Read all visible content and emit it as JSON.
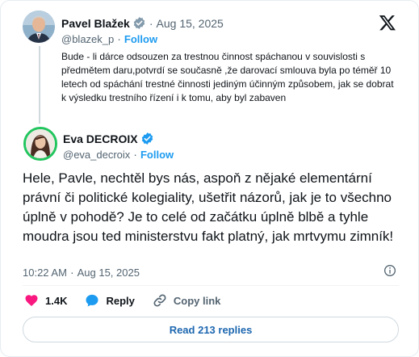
{
  "parent_tweet": {
    "author_name": "Pavel Blažek",
    "date": "Aug 15, 2025",
    "handle": "@blazek_p",
    "follow_label": "Follow",
    "text": "Bude - li dárce odsouzen za trestnou činnost spáchanou v souvislosti s předmětem daru,potvrdí  se současně ,že darovací smlouva byla po téměř 10 letech od spáchání trestné činnosti jediným účinným způsobem, jak se dobrat k výsledku trestního řízení i k tomu, aby byl zabaven"
  },
  "main_tweet": {
    "author_name": "Eva DECROIX",
    "handle": "@eva_decroix",
    "follow_label": "Follow",
    "text": "Hele, Pavle, nechtěl bys nás, aspoň z nějaké elementární právní či politické kolegiality, ušetřit názorů, jak je to všechno úplně v pohodě? Je to celé od začátku úplně blbě a tyhle moudra jsou ted ministerstvu fakt platný, jak mrtvymu zimník!",
    "time": "10:22 AM",
    "date": "Aug 15, 2025"
  },
  "actions": {
    "likes": "1.4K",
    "reply_label": "Reply",
    "copy_link_label": "Copy link"
  },
  "read_replies_label": "Read 213 replies",
  "separator_dot": "·",
  "colors": {
    "accent": "#1d9bf0",
    "like": "#f91880",
    "avatar_ring": "#22c55e",
    "muted": "#536471"
  },
  "icons": [
    "x-logo-icon",
    "verified-badge-icon",
    "info-icon",
    "heart-icon",
    "reply-bubble-icon",
    "link-icon"
  ]
}
